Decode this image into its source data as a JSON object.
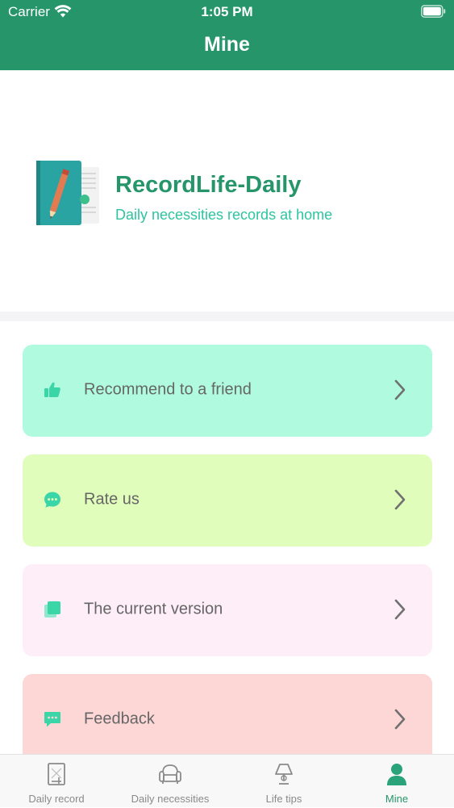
{
  "status_bar": {
    "carrier": "Carrier",
    "time": "1:05 PM"
  },
  "nav": {
    "title": "Mine"
  },
  "profile": {
    "app_name": "RecordLife-Daily",
    "tagline": "Daily necessities records at home"
  },
  "menu": {
    "items": [
      {
        "label": "Recommend to a friend",
        "icon": "thumbs-up-icon",
        "bg": "#b0fbe0"
      },
      {
        "label": "Rate us",
        "icon": "chat-bubble-icon",
        "bg": "#e1fdbc"
      },
      {
        "label": "The current version",
        "icon": "copy-icon",
        "bg": "#fdeef7"
      },
      {
        "label": "Feedback",
        "icon": "message-icon",
        "bg": "#fdd6d6"
      }
    ]
  },
  "tabs": [
    {
      "label": "Daily record",
      "icon": "clipboard-icon",
      "active": false
    },
    {
      "label": "Daily necessities",
      "icon": "sofa-icon",
      "active": false
    },
    {
      "label": "Life tips",
      "icon": "lamp-icon",
      "active": false
    },
    {
      "label": "Mine",
      "icon": "person-icon",
      "active": true
    }
  ],
  "colors": {
    "brand": "#26966a",
    "accent": "#2ec4a0",
    "icon": "#3bd6a8",
    "tab_inactive": "#8a8a8a"
  }
}
